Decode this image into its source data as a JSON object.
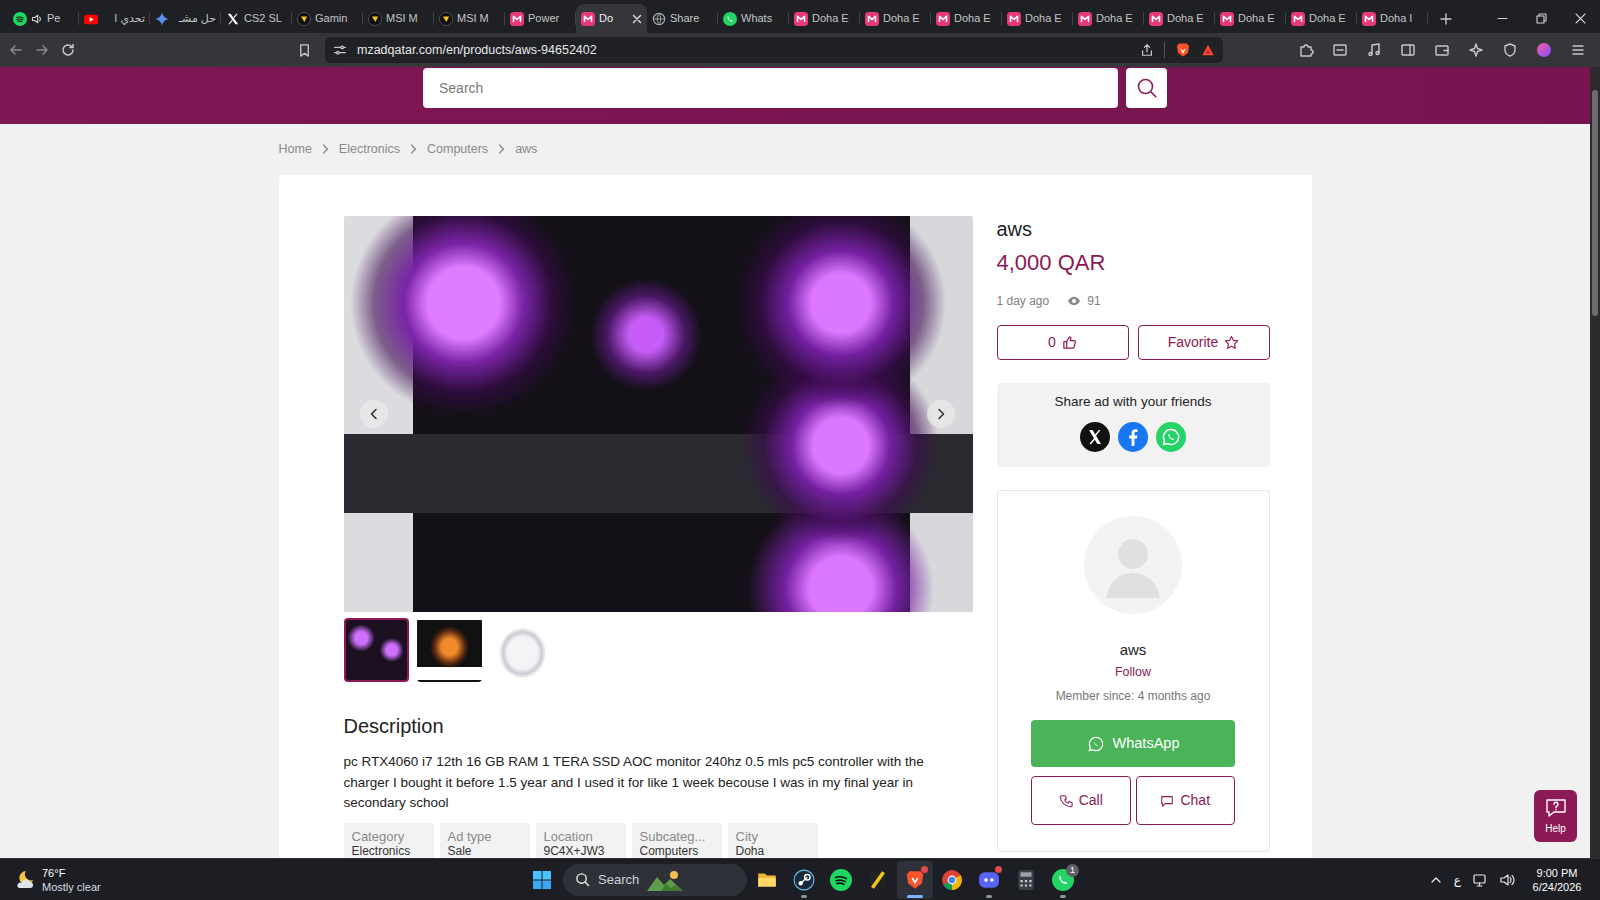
{
  "browser": {
    "tabs": [
      {
        "label": "Pe",
        "kind": "spotify",
        "audio": true,
        "selected": false
      },
      {
        "label": "تحدي ا",
        "kind": "youtube",
        "selected": false
      },
      {
        "label": "حل مشـ",
        "kind": "gemini",
        "selected": false
      },
      {
        "label": "CS2 SL",
        "kind": "x",
        "selected": false
      },
      {
        "label": "Gamin",
        "kind": "msi",
        "selected": false
      },
      {
        "label": "MSI M",
        "kind": "msi",
        "selected": false
      },
      {
        "label": "MSI M",
        "kind": "msi",
        "selected": false
      },
      {
        "label": "Power",
        "kind": "mzad",
        "selected": false
      },
      {
        "label": "Do",
        "kind": "mzad",
        "selected": true
      },
      {
        "label": "Share",
        "kind": "globe",
        "selected": false
      },
      {
        "label": "Whats",
        "kind": "whatsapp",
        "selected": false
      },
      {
        "label": "Doha E",
        "kind": "mzad",
        "selected": false
      },
      {
        "label": "Doha E",
        "kind": "mzad",
        "selected": false
      },
      {
        "label": "Doha E",
        "kind": "mzad",
        "selected": false
      },
      {
        "label": "Doha E",
        "kind": "mzad",
        "selected": false
      },
      {
        "label": "Doha E",
        "kind": "mzad",
        "selected": false
      },
      {
        "label": "Doha E",
        "kind": "mzad",
        "selected": false
      },
      {
        "label": "Doha E",
        "kind": "mzad",
        "selected": false
      },
      {
        "label": "Doha E",
        "kind": "mzad",
        "selected": false
      },
      {
        "label": "Doha I",
        "kind": "mzad",
        "selected": false
      }
    ],
    "url": "mzadqatar.com/en/products/aws-94652402"
  },
  "site": {
    "search": {
      "placeholder": "Search"
    },
    "breadcrumb": [
      {
        "label": "Home"
      },
      {
        "label": "Electronics"
      },
      {
        "label": "Computers"
      },
      {
        "label": "aws"
      }
    ],
    "product": {
      "title": "aws",
      "price": "4,000 QAR",
      "posted": "1 day ago",
      "views": "91",
      "likes": "0",
      "favorite": "Favorite",
      "share_title": "Share ad with your friends",
      "share_targets": [
        {
          "kind": "x"
        },
        {
          "kind": "facebook"
        },
        {
          "kind": "whatsapp"
        }
      ],
      "images": [
        {
          "selected": true
        },
        {
          "selected": false
        },
        {
          "selected": false
        }
      ],
      "description_title": "Description",
      "description": "pc RTX4060 i7 12th 16 GB RAM 1 TERA SSD AOC monitor 240hz 0.5 mls pc5 controller with the charger I bought it before 1.5 year and I used it for like 1 week becouse I was in my final year in secondary school",
      "details": [
        {
          "label": "Category",
          "value": "Electronics"
        },
        {
          "label": "Ad type",
          "value": "Sale"
        },
        {
          "label": "Location",
          "value": "9C4X+JW3"
        },
        {
          "label": "Subcateg...",
          "value": "Computers"
        },
        {
          "label": "City",
          "value": "Doha"
        }
      ]
    },
    "seller": {
      "name": "aws",
      "follow": "Follow",
      "member_since": "Member since: 4 months ago",
      "whatsapp": "WhatsApp",
      "call": "Call",
      "chat": "Chat"
    },
    "help": "Help"
  },
  "taskbar": {
    "weather": {
      "temperature": "76°F",
      "condition": "Mostly clear"
    },
    "search": "Search",
    "apps": [
      {
        "kind": "explorer",
        "running": false,
        "selected": false,
        "alert": false
      },
      {
        "kind": "steam",
        "running": true,
        "selected": false,
        "alert": false
      },
      {
        "kind": "spotify",
        "running": false,
        "selected": false,
        "alert": false
      },
      {
        "kind": "kapp",
        "running": false,
        "selected": false,
        "alert": false
      },
      {
        "kind": "brave",
        "running": true,
        "selected": true,
        "alert": true
      },
      {
        "kind": "chrome",
        "running": false,
        "selected": false,
        "alert": false
      },
      {
        "kind": "discord",
        "running": true,
        "selected": false,
        "alert": true
      },
      {
        "kind": "calculator",
        "running": false,
        "selected": false,
        "alert": false
      },
      {
        "kind": "whatsapp",
        "running": true,
        "selected": false,
        "alert": false,
        "badge": "1"
      }
    ],
    "language": "ع",
    "time": "9:00 PM",
    "date": "6/24/2026"
  }
}
